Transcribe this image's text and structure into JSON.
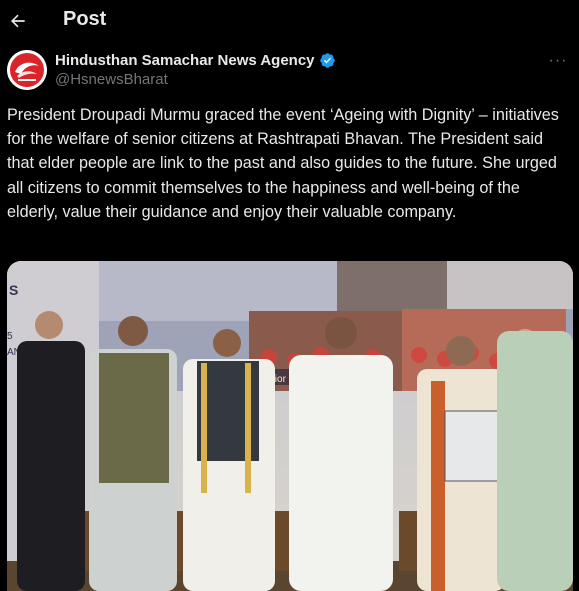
{
  "header": {
    "title": "Post"
  },
  "author": {
    "display_name": "Hindusthan Samachar News Agency",
    "handle": "@HsnewsBharat",
    "verified_color": "#1d9bf0"
  },
  "post": {
    "text": "President Droupadi Murmu graced the event ‘Ageing with Dignity’ – initiatives for the welfare of senior citizens at Rashtrapati Bhavan. The President said that elder people are link to the past and also guides to the future. She urged all citizens to commit themselves to the happiness and well-being of the elderly, value their guidance and enjoy their valuable company."
  },
  "photo": {
    "screen_text_1": "Senior Ci",
    "left_edge_text": [
      "S",
      "5",
      "AN"
    ]
  },
  "colors": {
    "background": "#000000",
    "text_primary": "#e7e9ea",
    "text_secondary": "#71767b",
    "brand": "#d9252a"
  },
  "icons": {
    "back": "arrow-left-icon",
    "verified": "verified-badge-icon",
    "more": "more-horizontal-icon"
  }
}
